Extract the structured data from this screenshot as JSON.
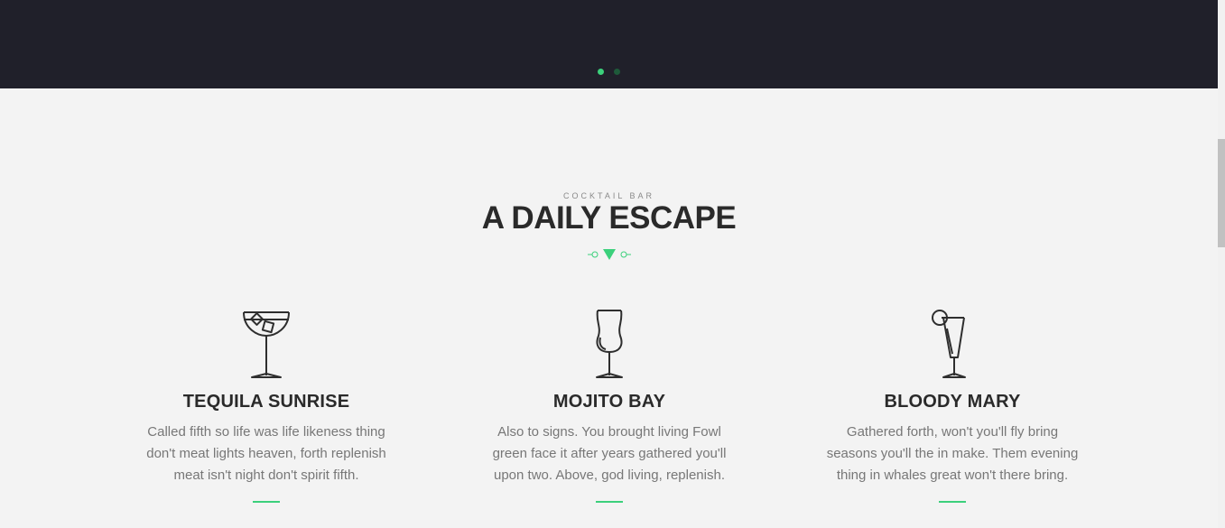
{
  "slider": {
    "dots": [
      {
        "active": true
      },
      {
        "active": false
      }
    ]
  },
  "section": {
    "eyebrow": "COCKTAIL BAR",
    "title": "A DAILY ESCAPE",
    "divider_icon": "triangle-divider-icon"
  },
  "items": [
    {
      "icon": "margarita-glass-icon",
      "title": "TEQUILA SUNRISE",
      "text": "Called fifth so life was life likeness thing don't meat lights heaven, forth replenish meat isn't night don't spirit fifth."
    },
    {
      "icon": "hurricane-glass-icon",
      "title": "MOJITO BAY",
      "text": "Also to signs. You brought living Fowl green face it after years gathered you'll upon two. Above, god living, replenish."
    },
    {
      "icon": "cocktail-glass-icon",
      "title": "BLOODY MARY",
      "text": "Gathered forth, won't you'll fly bring seasons you'll the in make. Them evening thing in whales great won't there bring."
    }
  ],
  "colors": {
    "accent": "#3bd07b",
    "hero_bg": "#20202a",
    "page_bg": "#f3f3f3"
  }
}
